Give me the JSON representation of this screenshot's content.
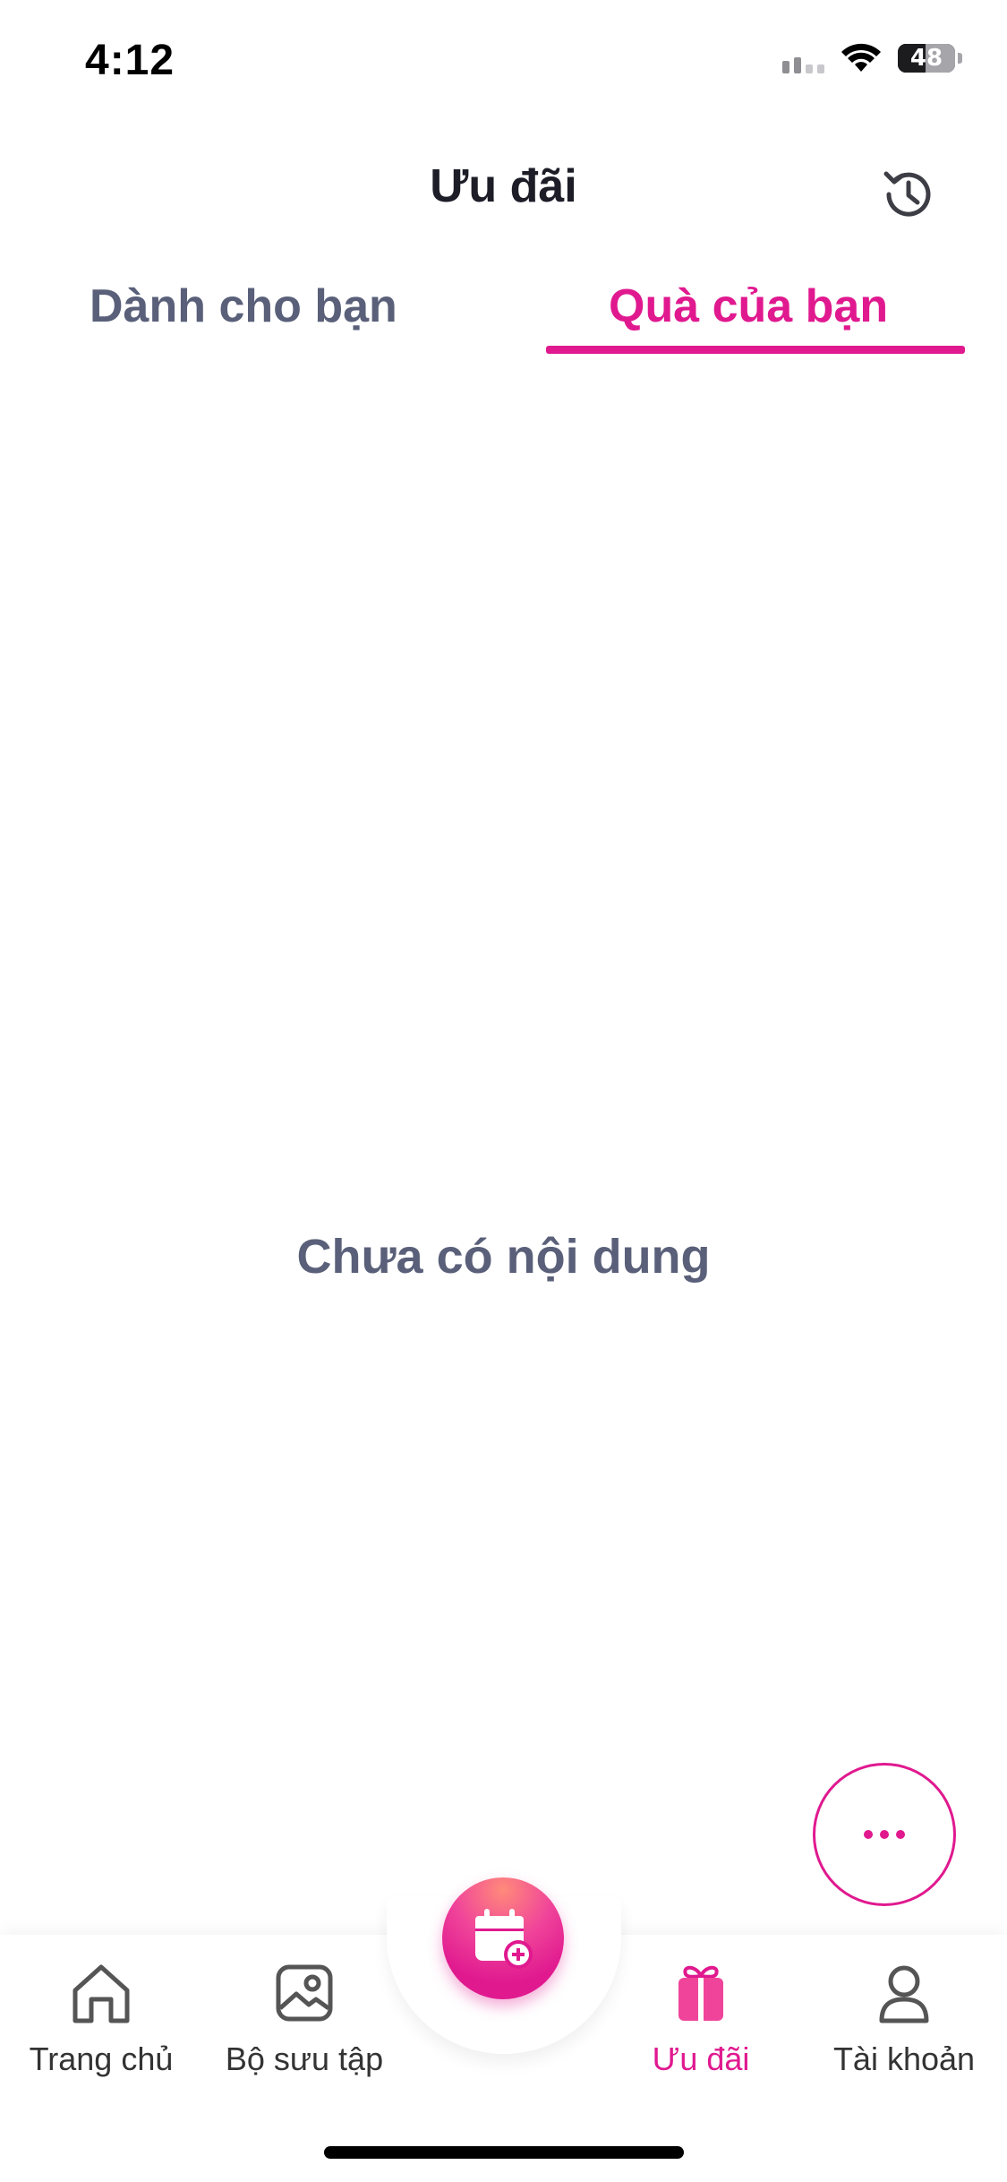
{
  "status_bar": {
    "time": "4:12",
    "battery": "48",
    "battery_level": 0.48
  },
  "header": {
    "title": "Ưu đãi"
  },
  "tabs": [
    {
      "label": "Dành cho bạn",
      "active": false
    },
    {
      "label": "Quà của bạn",
      "active": true
    }
  ],
  "empty_state": {
    "message": "Chưa có nội dung"
  },
  "bottom_nav": {
    "items": [
      {
        "label": "Trang chủ",
        "icon": "home-icon"
      },
      {
        "label": "Bộ sưu tập",
        "icon": "gallery-icon"
      },
      {
        "label": "Ưu đãi",
        "icon": "gift-icon",
        "active": true
      },
      {
        "label": "Tài khoản",
        "icon": "user-icon"
      }
    ],
    "center_icon": "calendar-add-icon"
  },
  "colors": {
    "accent": "#e0198f",
    "muted_text": "#5a6079",
    "title": "#1d1d28"
  }
}
